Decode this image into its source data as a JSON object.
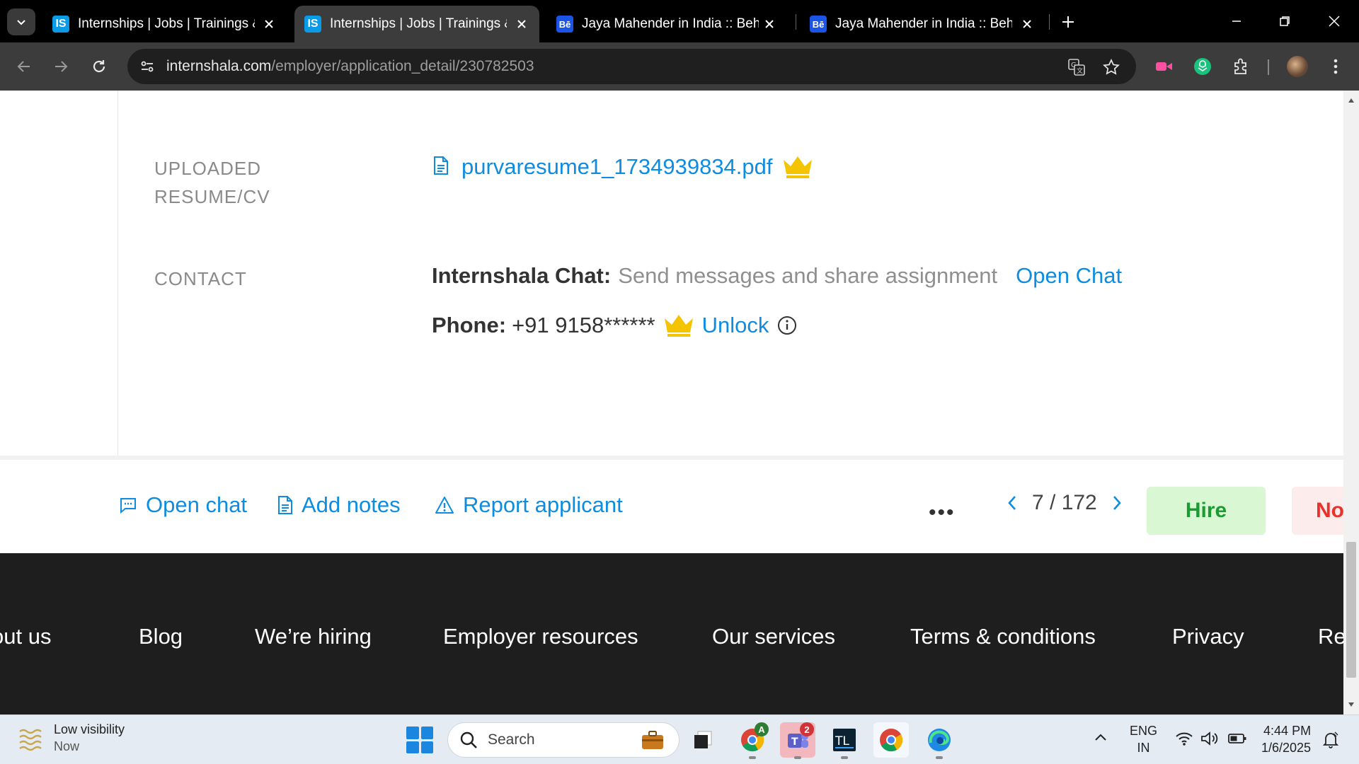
{
  "browser": {
    "tabs": [
      {
        "title": "Internships | Jobs | Trainings & I",
        "favicon": "IS",
        "active": false
      },
      {
        "title": "Internships | Jobs | Trainings & I",
        "favicon": "IS",
        "active": true
      },
      {
        "title": "Jaya Mahender in India :: Behan",
        "favicon": "Bē",
        "active": false
      },
      {
        "title": "Jaya Mahender in India :: Behan",
        "favicon": "Bē",
        "active": false
      }
    ],
    "url_domain": "internshala.com",
    "url_path": "/employer/application_detail/230782503"
  },
  "application": {
    "resume_label": "UPLOADED RESUME/CV",
    "resume_label_line1": "UPLOADED",
    "resume_label_line2": "RESUME/CV",
    "resume_file": "purvaresume1_1734939834.pdf",
    "contact_label": "CONTACT",
    "chat_label": "Internshala Chat:",
    "chat_desc": "Send messages and share assignment",
    "open_chat_link": "Open Chat",
    "phone_label": "Phone:",
    "phone_value": "+91 9158******",
    "unlock_link": "Unlock"
  },
  "actionbar": {
    "open_chat": "Open chat",
    "add_notes": "Add notes",
    "report_applicant": "Report applicant",
    "more": "•••",
    "pager": "7 / 172",
    "hire": "Hire",
    "not_interested": "No"
  },
  "footer": {
    "links": [
      "out us",
      "Blog",
      "We’re hiring",
      "Employer resources",
      "Our services",
      "Terms & conditions",
      "Privacy",
      "Re"
    ]
  },
  "taskbar": {
    "weather_title": "Low visibility",
    "weather_sub": "Now",
    "search_placeholder": "Search",
    "teams_badge": "2",
    "chrome_badge": "A",
    "lang_line1": "ENG",
    "lang_line2": "IN",
    "time": "4:44 PM",
    "date": "1/6/2025"
  },
  "colors": {
    "link": "#0e8de0",
    "hire_bg": "#d9f7d2",
    "hire_text": "#1a9c33",
    "crown": "#f5c400",
    "footer_bg": "#1e1e1e"
  },
  "icons": [
    "chevron-down-icon",
    "close-icon",
    "plus-icon",
    "minimize-icon",
    "restore-icon",
    "back-icon",
    "forward-icon",
    "reload-icon",
    "site-info-icon",
    "translate-icon",
    "star-icon",
    "extensions-icon",
    "more-vert-icon",
    "document-icon",
    "crown-icon",
    "info-icon",
    "chat-icon",
    "notes-icon",
    "warning-icon",
    "chevron-left-icon",
    "chevron-right-icon",
    "search-icon",
    "wifi-icon",
    "volume-icon",
    "battery-icon"
  ]
}
